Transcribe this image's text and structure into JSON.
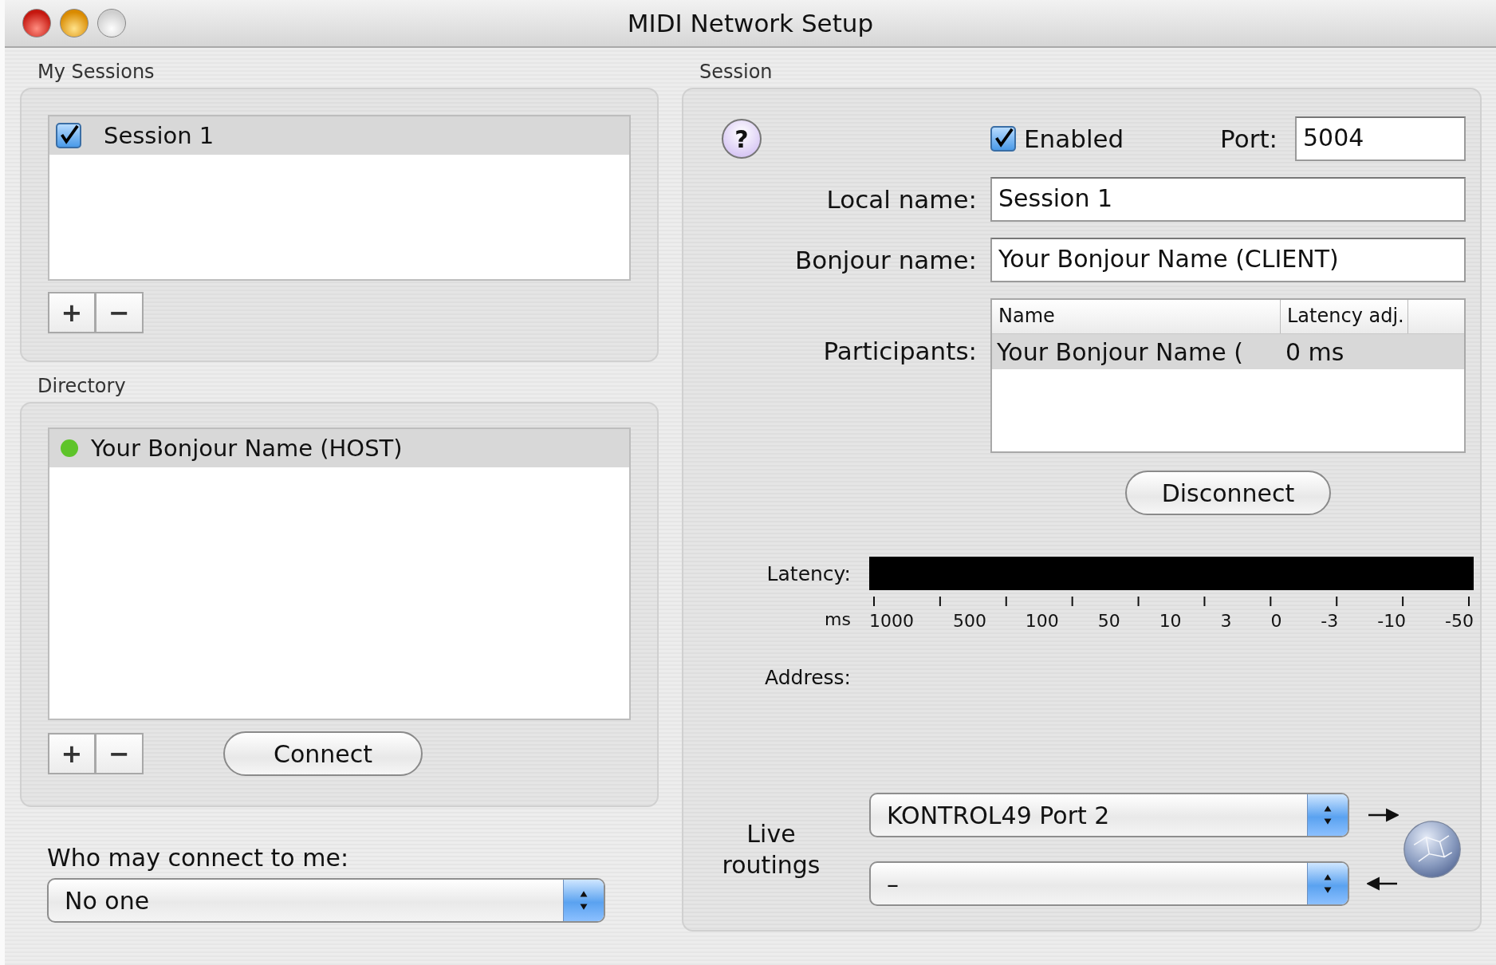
{
  "window": {
    "title": "MIDI Network Setup"
  },
  "my_sessions": {
    "title": "My Sessions",
    "items": [
      {
        "label": "Session 1",
        "checked": true,
        "selected": true
      }
    ],
    "add": "+",
    "remove": "−"
  },
  "directory": {
    "title": "Directory",
    "items": [
      {
        "label": "Your Bonjour Name (HOST)",
        "color": "#5ec42a",
        "selected": true
      }
    ],
    "add": "+",
    "remove": "−",
    "connect": "Connect"
  },
  "who_may_connect": {
    "label": "Who may connect to me:",
    "value": "No one"
  },
  "session": {
    "title": "Session",
    "help": "?",
    "enabled": {
      "label": "Enabled",
      "checked": true
    },
    "port": {
      "label": "Port:",
      "value": "5004"
    },
    "local_name": {
      "label": "Local name:",
      "value": "Session 1"
    },
    "bonjour_name": {
      "label": "Bonjour name:",
      "value": "Your Bonjour Name (CLIENT)"
    },
    "participants": {
      "label": "Participants:",
      "columns": [
        "Name",
        "Latency adj."
      ],
      "rows": [
        {
          "name": "Your Bonjour Name (",
          "latency": "0 ms",
          "selected": true
        }
      ]
    },
    "disconnect": "Disconnect",
    "latency": {
      "label": "Latency:",
      "unit": "ms",
      "ticks": [
        "1000",
        "500",
        "100",
        "50",
        "10",
        "3",
        "0",
        "-3",
        "-10",
        "-50"
      ]
    },
    "address": {
      "label": "Address:"
    },
    "live_routings": {
      "label": "Live routings",
      "outgoing": "KONTROL49 Port 2",
      "incoming": "–"
    }
  }
}
